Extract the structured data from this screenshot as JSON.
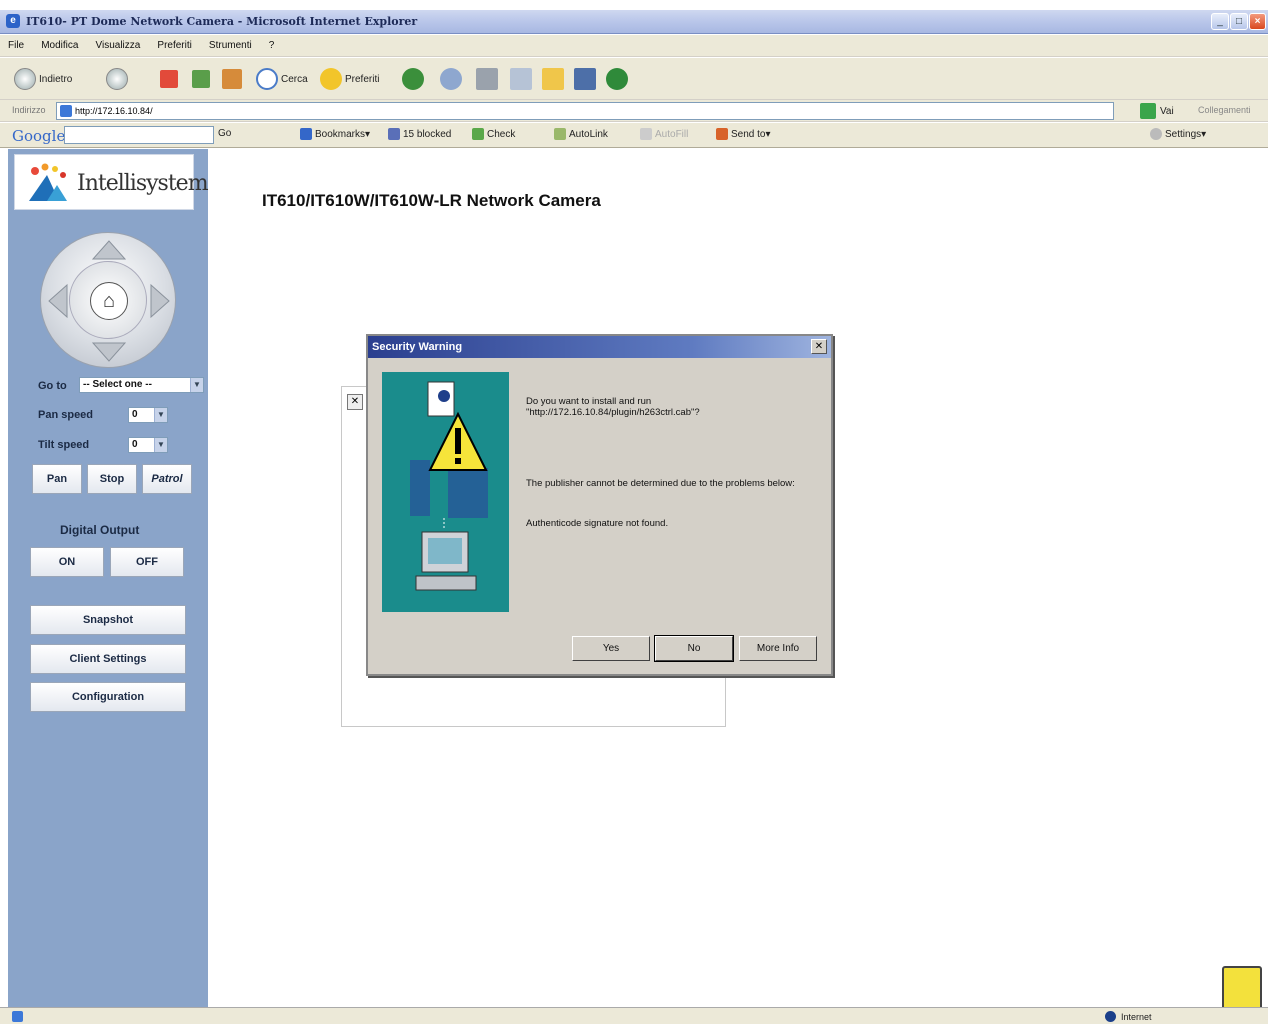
{
  "window": {
    "title": "IT610- PT Dome Network Camera - Microsoft Internet Explorer",
    "controls": [
      "_",
      "□",
      "×"
    ]
  },
  "menu": [
    "File",
    "Modifica",
    "Visualizza",
    "Preferiti",
    "Strumenti",
    "?"
  ],
  "toolbar": {
    "back_label": "Indietro",
    "search_label": "Cerca",
    "favorites_label": "Preferiti"
  },
  "address": {
    "label": "Indirizzo",
    "url": "http://172.16.10.84/",
    "go_label": "Vai",
    "links_label": "Collegamenti"
  },
  "google_toolbar": {
    "logo": "Google",
    "logo_suffix": "G▾",
    "go_label": "Go",
    "bookmarks_label": "Bookmarks▾",
    "blocked_label": "15 blocked",
    "check_label": "Check",
    "autolink_label": "AutoLink",
    "autofill_label": "AutoFill",
    "sendto_label": "Send to▾",
    "settings_label": "Settings▾"
  },
  "sidebar": {
    "brand": "Intellisystem",
    "goto_label": "Go to",
    "goto_value": "-- Select one --",
    "pan_speed_label": "Pan speed",
    "pan_speed_value": "0",
    "tilt_speed_label": "Tilt speed",
    "tilt_speed_value": "0",
    "pan_button": "Pan",
    "stop_button": "Stop",
    "patrol_button": "Patrol",
    "digital_output_title": "Digital Output",
    "on_button": "ON",
    "off_button": "OFF",
    "snapshot_button": "Snapshot",
    "client_settings_button": "Client Settings",
    "configuration_button": "Configuration"
  },
  "main": {
    "heading": "IT610/IT610W/IT610W-LR Network Camera"
  },
  "dialog": {
    "title": "Security Warning",
    "question_line1": "Do you want to install and run",
    "question_line2": "\"http://172.16.10.84/plugin/h263ctrl.cab\"?",
    "publisher_msg": "The publisher cannot be determined due to the problems below:",
    "signature_msg": "Authenticode signature not found.",
    "yes_button": "Yes",
    "no_button": "No",
    "more_info_button": "More Info"
  },
  "statusbar": {
    "zone": "Internet"
  },
  "colors": {
    "sidebar": "#8aa4c9",
    "dialog_art": "#1a8c8c",
    "title_gradient_start": "#2b3f8f"
  }
}
